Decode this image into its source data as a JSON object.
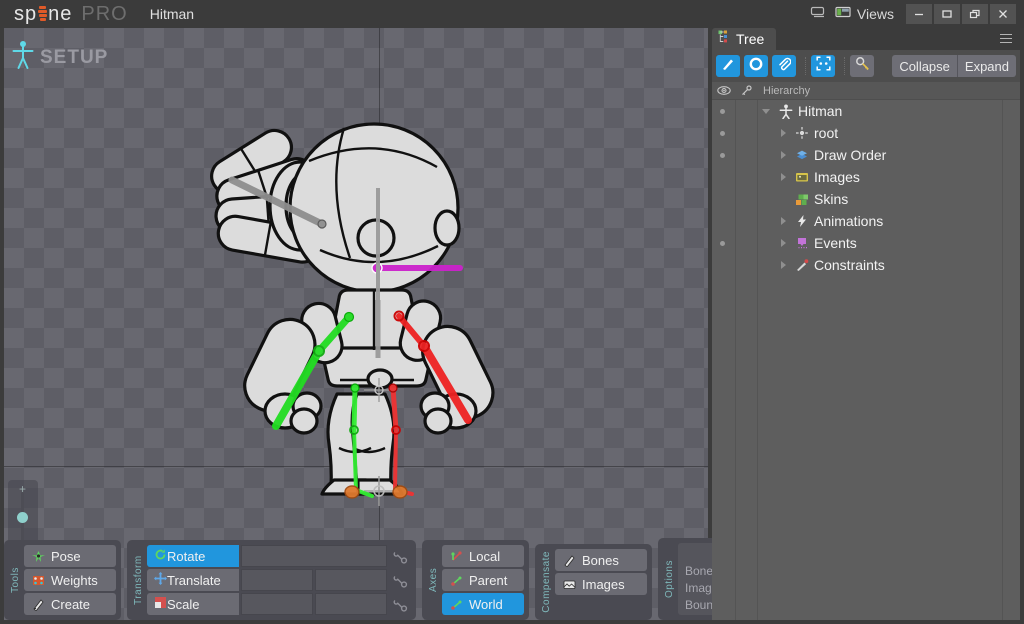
{
  "app": {
    "brand_main": "sp ne",
    "brand_pre": "sp",
    "brand_post": "ne",
    "brand_edition": "PRO",
    "document_title": "Hitman",
    "accent_orange": "#e05a28",
    "accent_blue": "#2196dd",
    "panel_bg": "#4a4a52",
    "tree_bg": "#5e5e5e"
  },
  "titlebar": {
    "views_label": "Views",
    "screen_icon": "monitor-icon",
    "views_icon": "views-layout-icon",
    "window_buttons": [
      {
        "name": "minimize",
        "glyph": "—"
      },
      {
        "name": "maximize",
        "glyph": "▭"
      },
      {
        "name": "restore",
        "glyph": "❐"
      },
      {
        "name": "close",
        "glyph": "✕"
      }
    ]
  },
  "viewport": {
    "mode_label": "SETUP",
    "mode_icon": "skeleton-figure-icon",
    "left_tools": [
      {
        "name": "zoom-slider",
        "icon": "zoom-slider"
      },
      {
        "name": "magnifier",
        "icon": "magnifier-icon"
      },
      {
        "name": "frame-selection",
        "icon": "frame-selection-icon"
      },
      {
        "name": "lock",
        "icon": "lock-icon"
      }
    ],
    "zoom_plus": "+",
    "zoom_minus": "–"
  },
  "dock": {
    "tools": {
      "label": "Tools",
      "buttons": [
        {
          "label": "Pose",
          "icon": "pose-icon",
          "active": false
        },
        {
          "label": "Weights",
          "icon": "weights-icon",
          "active": false
        },
        {
          "label": "Create",
          "icon": "create-icon",
          "active": false
        }
      ]
    },
    "transform": {
      "label": "Transform",
      "rows": [
        {
          "label": "Rotate",
          "icon": "rotate-icon",
          "active": true,
          "fields": [
            ""
          ],
          "field_count": 1
        },
        {
          "label": "Translate",
          "icon": "translate-icon",
          "active": false,
          "fields": [
            "",
            ""
          ],
          "field_count": 2
        },
        {
          "label": "Scale",
          "icon": "scale-icon",
          "active": false,
          "fields": [
            "",
            ""
          ],
          "field_count": 2
        }
      ]
    },
    "axes": {
      "label": "Axes",
      "buttons": [
        {
          "label": "Local",
          "icon": "axes-local-icon",
          "active": false
        },
        {
          "label": "Parent",
          "icon": "axes-parent-icon",
          "active": false
        },
        {
          "label": "World",
          "icon": "axes-world-icon",
          "active": true
        }
      ]
    },
    "compensate": {
      "label": "Compensate",
      "buttons": [
        {
          "label": "Bones",
          "icon": "bones-icon",
          "active": false
        },
        {
          "label": "Images",
          "icon": "images-icon",
          "active": false
        }
      ]
    },
    "options": {
      "label": "Options",
      "columns": [
        {
          "name": "select-column",
          "icon": "cursor-arrow-icon"
        },
        {
          "name": "visible-column",
          "icon": "eye-icon"
        },
        {
          "name": "third-column",
          "icon": "corner-icon"
        }
      ],
      "rows": [
        {
          "label": "Bones",
          "select": true,
          "visible": true
        },
        {
          "label": "Images",
          "select": true,
          "visible": true
        },
        {
          "label": "Bounds",
          "select": true,
          "visible": true
        }
      ]
    }
  },
  "tree": {
    "tab_label": "Tree",
    "tab_icon": "tree-icon",
    "menu_icon": "hamburger-icon",
    "toolbar": {
      "icon_buttons": [
        {
          "name": "brush-tool",
          "icon": "brush-icon",
          "active": true
        },
        {
          "name": "circle-tool",
          "icon": "ring-icon",
          "active": true
        },
        {
          "name": "attachment-tool",
          "icon": "paperclip-icon",
          "active": true
        },
        {
          "name": "selection-tool",
          "icon": "selection-frame-icon",
          "active": true
        },
        {
          "name": "find-tool",
          "icon": "search-key-icon",
          "active": false
        }
      ],
      "collapse_label": "Collapse",
      "expand_label": "Expand"
    },
    "header": {
      "eye_icon": "eye-icon",
      "key_icon": "key-icon",
      "hierarchy_label": "Hierarchy"
    },
    "items": [
      {
        "label": "Hitman",
        "icon": "skeleton-icon",
        "indent": 0,
        "arrow": "down",
        "dot": true,
        "icon_color": "#e8e8e8"
      },
      {
        "label": "root",
        "icon": "bone-root-icon",
        "indent": 1,
        "arrow": "right",
        "dot": true,
        "icon_color": "#dcdcdc"
      },
      {
        "label": "Draw Order",
        "icon": "draw-order-icon",
        "indent": 1,
        "arrow": "right",
        "dot": true,
        "icon_color": "#4a8fd4"
      },
      {
        "label": "Images",
        "icon": "images-folder-icon",
        "indent": 1,
        "arrow": "right",
        "dot": false,
        "icon_color": "#d6c44a"
      },
      {
        "label": "Skins",
        "icon": "skins-icon",
        "indent": 1,
        "arrow": "none",
        "dot": false,
        "icon_color": "#5fae4e"
      },
      {
        "label": "Animations",
        "icon": "animation-icon",
        "indent": 1,
        "arrow": "right",
        "dot": false,
        "icon_color": "#e8e8e8"
      },
      {
        "label": "Events",
        "icon": "events-icon",
        "indent": 1,
        "arrow": "right",
        "dot": true,
        "icon_color": "#c273d8"
      },
      {
        "label": "Constraints",
        "icon": "constraints-icon",
        "indent": 1,
        "arrow": "right",
        "dot": false,
        "icon_color": "#d8d8d8"
      }
    ]
  }
}
